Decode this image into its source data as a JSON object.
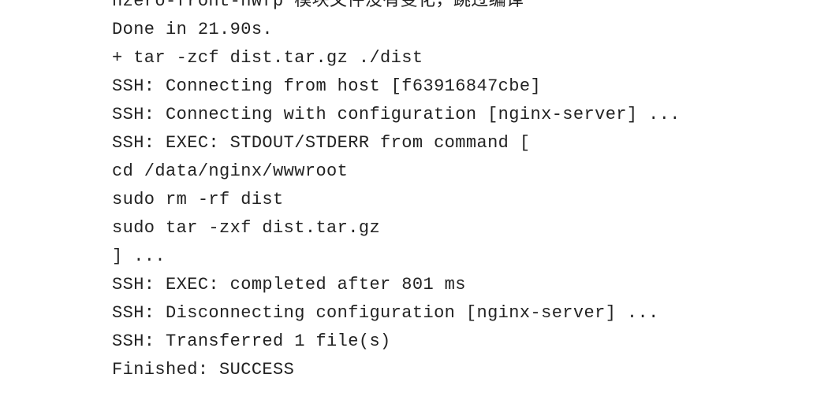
{
  "console": {
    "lines": [
      "hzero-front-hwfp 模块文件没有变化，跳过编译",
      "Done in 21.90s.",
      "+ tar -zcf dist.tar.gz ./dist",
      "SSH: Connecting from host [f63916847cbe]",
      "SSH: Connecting with configuration [nginx-server] ...",
      "SSH: EXEC: STDOUT/STDERR from command [",
      "cd /data/nginx/wwwroot",
      "sudo rm -rf dist",
      "sudo tar -zxf dist.tar.gz",
      "] ...",
      "SSH: EXEC: completed after 801 ms",
      "SSH: Disconnecting configuration [nginx-server] ...",
      "SSH: Transferred 1 file(s)",
      "Finished: SUCCESS"
    ]
  }
}
